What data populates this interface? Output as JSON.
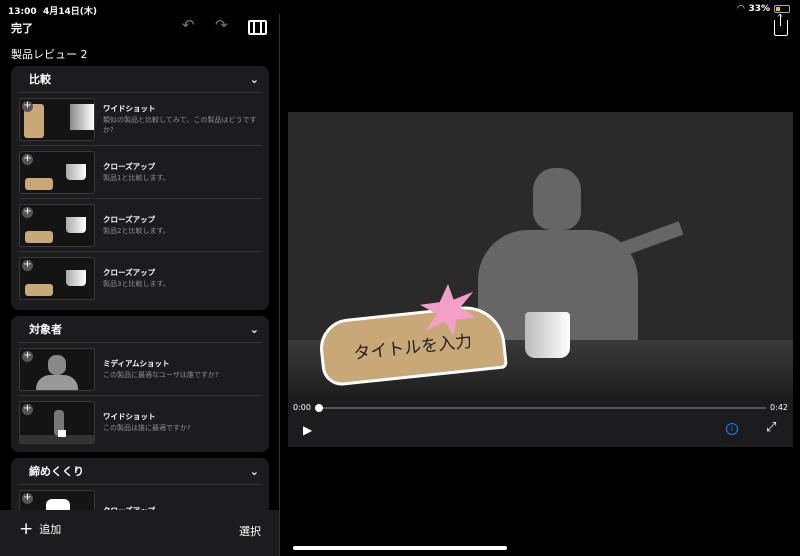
{
  "status": {
    "time": "13:00",
    "date": "4月14日(木)",
    "battery": "33%"
  },
  "toolbar": {
    "done": "完了",
    "undo_icon": "undo-icon",
    "redo_icon": "redo-icon",
    "add_clip_icon": "add-clip-icon"
  },
  "project_title": "製品レビュー 2",
  "sections": [
    {
      "title": "比較",
      "items": [
        {
          "title": "ワイドショット",
          "desc": "類似の製品と比較してみて、この製品はどうですか?"
        },
        {
          "title": "クローズアップ",
          "desc": "製品1と比較します。"
        },
        {
          "title": "クローズアップ",
          "desc": "製品2と比較します。"
        },
        {
          "title": "クローズアップ",
          "desc": "製品3と比較します。"
        }
      ]
    },
    {
      "title": "対象者",
      "items": [
        {
          "title": "ミディアムショット",
          "desc": "この製品に最適なユーザは誰ですか?"
        },
        {
          "title": "ワイドショット",
          "desc": "この製品は誰に最適ですか?"
        }
      ]
    },
    {
      "title": "締めくくり",
      "items": [
        {
          "title": "クローズアップ",
          "desc": ""
        }
      ]
    }
  ],
  "bottom": {
    "add": "追加",
    "select": "選択"
  },
  "video": {
    "title_placeholder": "タイトルを入力",
    "current_time": "0:00",
    "duration": "0:42",
    "progress": 0
  }
}
